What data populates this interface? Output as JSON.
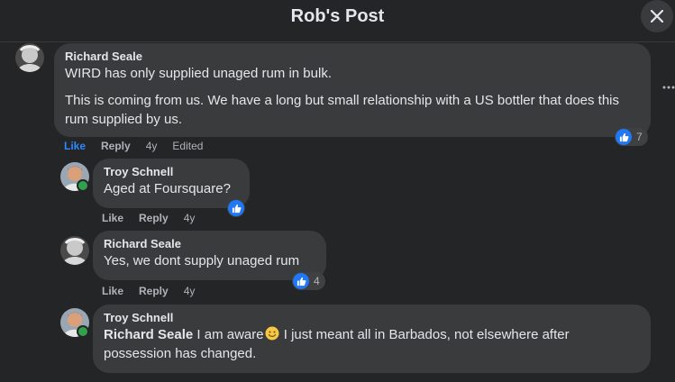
{
  "header": {
    "title": "Rob's Post"
  },
  "comments": [
    {
      "author": "Richard Seale",
      "paragraphs": [
        "WIRD has only supplied unaged rum in bulk.",
        "This is coming from us. We have a long but small relationship with a US bottler that does this rum supplied by us."
      ],
      "actions": {
        "like": "Like",
        "reply": "Reply",
        "time": "4y",
        "edited": "Edited"
      },
      "reaction_count": "7"
    },
    {
      "author": "Troy Schnell",
      "text": "Aged at Foursquare?",
      "actions": {
        "like": "Like",
        "reply": "Reply",
        "time": "4y"
      }
    },
    {
      "author": "Richard Seale",
      "text": "Yes, we dont supply unaged rum",
      "actions": {
        "like": "Like",
        "reply": "Reply",
        "time": "4y"
      },
      "reaction_count": "4"
    },
    {
      "author": "Troy Schnell",
      "mention": "Richard Seale",
      "text_before_emoji": "I am aware",
      "text_after_emoji": "I just meant all in Barbados, not elsewhere after possession has changed."
    }
  ],
  "colors": {
    "accent": "#2d88ff",
    "like_badge": "#2078f4",
    "bubble": "#3a3b3c",
    "background": "#242526"
  },
  "icons": [
    "close-icon",
    "more-icon",
    "like-reaction-icon",
    "smile-emoji-icon"
  ]
}
